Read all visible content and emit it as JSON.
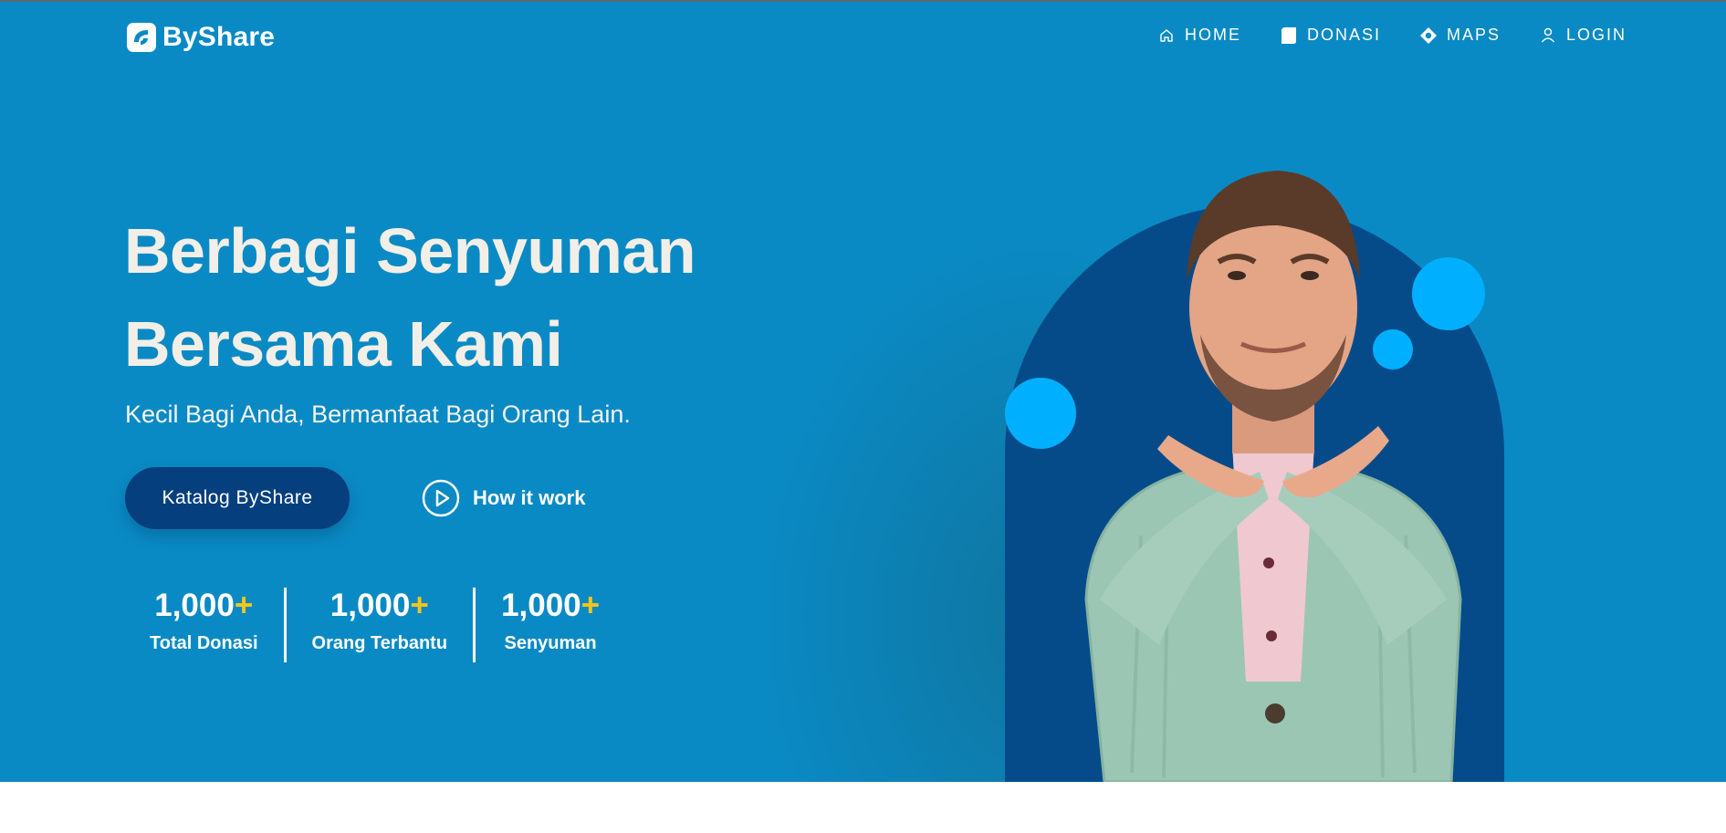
{
  "brand": {
    "name": "ByShare"
  },
  "nav": {
    "items": [
      {
        "label": "HOME",
        "icon": "home-icon"
      },
      {
        "label": "DONASI",
        "icon": "box-icon"
      },
      {
        "label": "MAPS",
        "icon": "location-icon"
      },
      {
        "label": "LOGIN",
        "icon": "user-icon"
      }
    ]
  },
  "hero": {
    "headline_line1": "Berbagi Senyuman",
    "headline_line2": "Bersama Kami",
    "subheadline": "Kecil Bagi Anda, Bermanfaat Bagi Orang Lain.",
    "primary_button": "Katalog ByShare",
    "secondary_link": "How it work"
  },
  "stats": [
    {
      "value": "1,000",
      "suffix": "+",
      "label": "Total Donasi"
    },
    {
      "value": "1,000",
      "suffix": "+",
      "label": "Orang Terbantu"
    },
    {
      "value": "1,000",
      "suffix": "+",
      "label": "Senyuman"
    }
  ],
  "colors": {
    "hero_bg": "#0a8ac4",
    "button_bg": "#053f7e",
    "arch": "#054b8a",
    "bubble": "#00b0ff",
    "accent_plus": "#f6c619",
    "headline": "#f2efe8"
  }
}
